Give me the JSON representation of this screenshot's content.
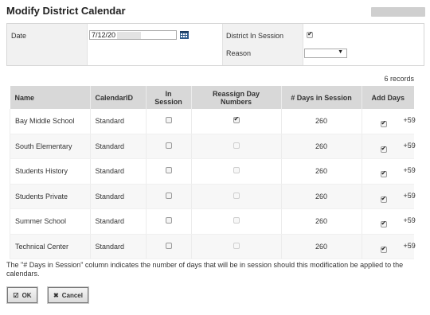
{
  "dialog": {
    "title": "Modify District Calendar"
  },
  "form": {
    "date_label": "Date",
    "date_value": "7/12/20",
    "district_in_session_label": "District In Session",
    "district_in_session_checked": true,
    "reason_label": "Reason",
    "reason_value": ""
  },
  "records_count": "6 records",
  "table": {
    "columns": [
      "Name",
      "CalendarID",
      "In Session",
      "Reassign Day Numbers",
      "# Days in Session",
      "Add Days"
    ],
    "rows": [
      {
        "name": "Bay Middle School",
        "calendar_id": "Standard",
        "in_session": false,
        "reassign": true,
        "reassign_enabled": true,
        "days": "260",
        "add_checked": true,
        "add_days": "+59"
      },
      {
        "name": "South Elementary",
        "calendar_id": "Standard",
        "in_session": false,
        "reassign": false,
        "reassign_enabled": false,
        "days": "260",
        "add_checked": true,
        "add_days": "+59"
      },
      {
        "name": "Students History",
        "calendar_id": "Standard",
        "in_session": false,
        "reassign": false,
        "reassign_enabled": false,
        "days": "260",
        "add_checked": true,
        "add_days": "+59"
      },
      {
        "name": "Students Private",
        "calendar_id": "Standard",
        "in_session": false,
        "reassign": false,
        "reassign_enabled": false,
        "days": "260",
        "add_checked": true,
        "add_days": "+59"
      },
      {
        "name": "Summer School",
        "calendar_id": "Standard",
        "in_session": false,
        "reassign": false,
        "reassign_enabled": false,
        "days": "260",
        "add_checked": true,
        "add_days": "+59"
      },
      {
        "name": "Technical Center",
        "calendar_id": "Standard",
        "in_session": false,
        "reassign": false,
        "reassign_enabled": false,
        "days": "260",
        "add_checked": true,
        "add_days": "+59"
      }
    ]
  },
  "footnote": "The \"# Days in Session\" column indicates the number of days that will be in session should this modification be applied to the calendars.",
  "buttons": {
    "ok_label": "OK",
    "cancel_label": "Cancel",
    "ok_icon": "check-square-icon",
    "cancel_icon": "x-icon"
  },
  "colors": {
    "header_bg": "#d8d8d8",
    "label_bg": "#f1f1f1",
    "row_alt_bg": "#f7f7f7"
  }
}
